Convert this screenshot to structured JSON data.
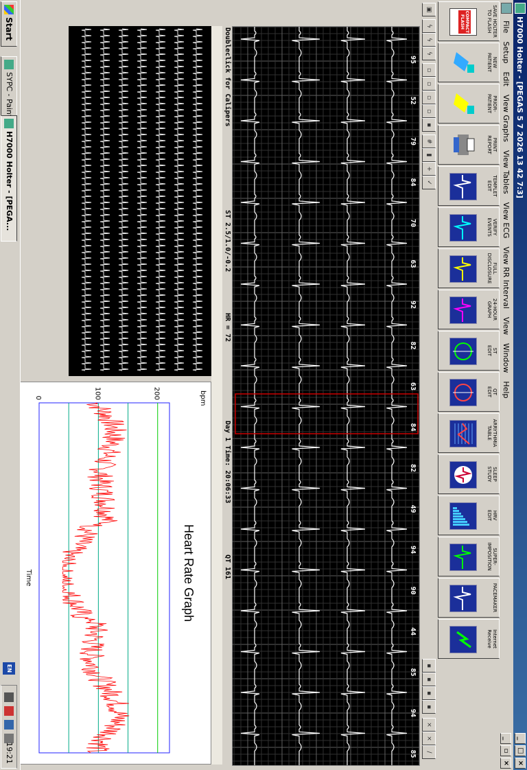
{
  "window": {
    "title": "H7000 Holter - [PEGAS 5 7 2026 13 42 7:3]"
  },
  "menu": [
    "File",
    "Setup",
    "Edit",
    "View Graphs",
    "View Tables",
    "View ECG",
    "View RR Interval",
    "View",
    "Window",
    "Help"
  ],
  "toolbar": [
    {
      "id": "save-holter",
      "label": "SAVE HOLTER\nTO FLASH",
      "icon": "compact-flash-icon",
      "badge": "COMPACT\nFLASH"
    },
    {
      "id": "new-patient",
      "label": "NEW\nPATIENT",
      "icon": "new-patient-icon"
    },
    {
      "id": "prior-patient",
      "label": "PRIOR-\nPATIENT",
      "icon": "prior-patient-icon"
    },
    {
      "id": "print-report",
      "label": "PRINT\nREPORT",
      "icon": "printer-icon"
    },
    {
      "id": "templet-edit",
      "label": "TEMPLET\nEDIT",
      "icon": "template-icon"
    },
    {
      "id": "verify-events",
      "label": "VERIFY\nEVENTS",
      "icon": "verify-events-icon"
    },
    {
      "id": "full-disclosure",
      "label": "FULL\nDISCLOSURE",
      "icon": "full-disclosure-icon"
    },
    {
      "id": "24-hour-graph",
      "label": "24-HOUR\nGRAPH",
      "icon": "24-hour-graph-icon"
    },
    {
      "id": "st-edit",
      "label": "ST\nEDIT",
      "icon": "st-edit-icon"
    },
    {
      "id": "qt-edit",
      "label": "QT\nEDIT",
      "icon": "qt-edit-icon"
    },
    {
      "id": "arrhythmia",
      "label": "ARRYTHMIA\nTABLE",
      "icon": "arrhythmia-table-icon"
    },
    {
      "id": "sleep-study",
      "label": "SLEEP\nSTUDY",
      "icon": "sleep-study-icon"
    },
    {
      "id": "hrv-edit",
      "label": "HRV\nEDIT",
      "icon": "hrv-icon"
    },
    {
      "id": "superimposition",
      "label": "SUPER-\nIMPOSITION",
      "icon": "superimposition-icon"
    },
    {
      "id": "pacemaker",
      "label": "PACEMAKER",
      "icon": "pacemaker-icon"
    },
    {
      "id": "internet-receive",
      "label": "Internet\nReceive",
      "icon": "internet-receive-icon"
    }
  ],
  "ecg": {
    "rr_labels": [
      "95",
      "52",
      "79",
      "84",
      "70",
      "63",
      "92",
      "82",
      "63",
      "84",
      "82",
      "49",
      "94",
      "90",
      "44",
      "85",
      "94",
      "85"
    ],
    "status": {
      "doubleclick": "Doubleclick for Calipers",
      "st": "ST 2.5/1.0/-0.2",
      "hr": "HR = 72",
      "time": "Day 1 Time: 20:06:33",
      "qt": "QT 161"
    }
  },
  "hr_graph": {
    "title": "Heart Rate Graph",
    "ylabel": "bpm",
    "xlabel": "Time",
    "ylim": [
      0,
      220
    ],
    "yticks": [
      "0",
      "100",
      "200"
    ],
    "line_color": "#ff0000"
  },
  "taskbar": {
    "start": "Start",
    "tasks": [
      "SYPC - Paint",
      "H7000 Holter - [PEGA..."
    ],
    "lang": "EN",
    "clock": "19:21"
  }
}
